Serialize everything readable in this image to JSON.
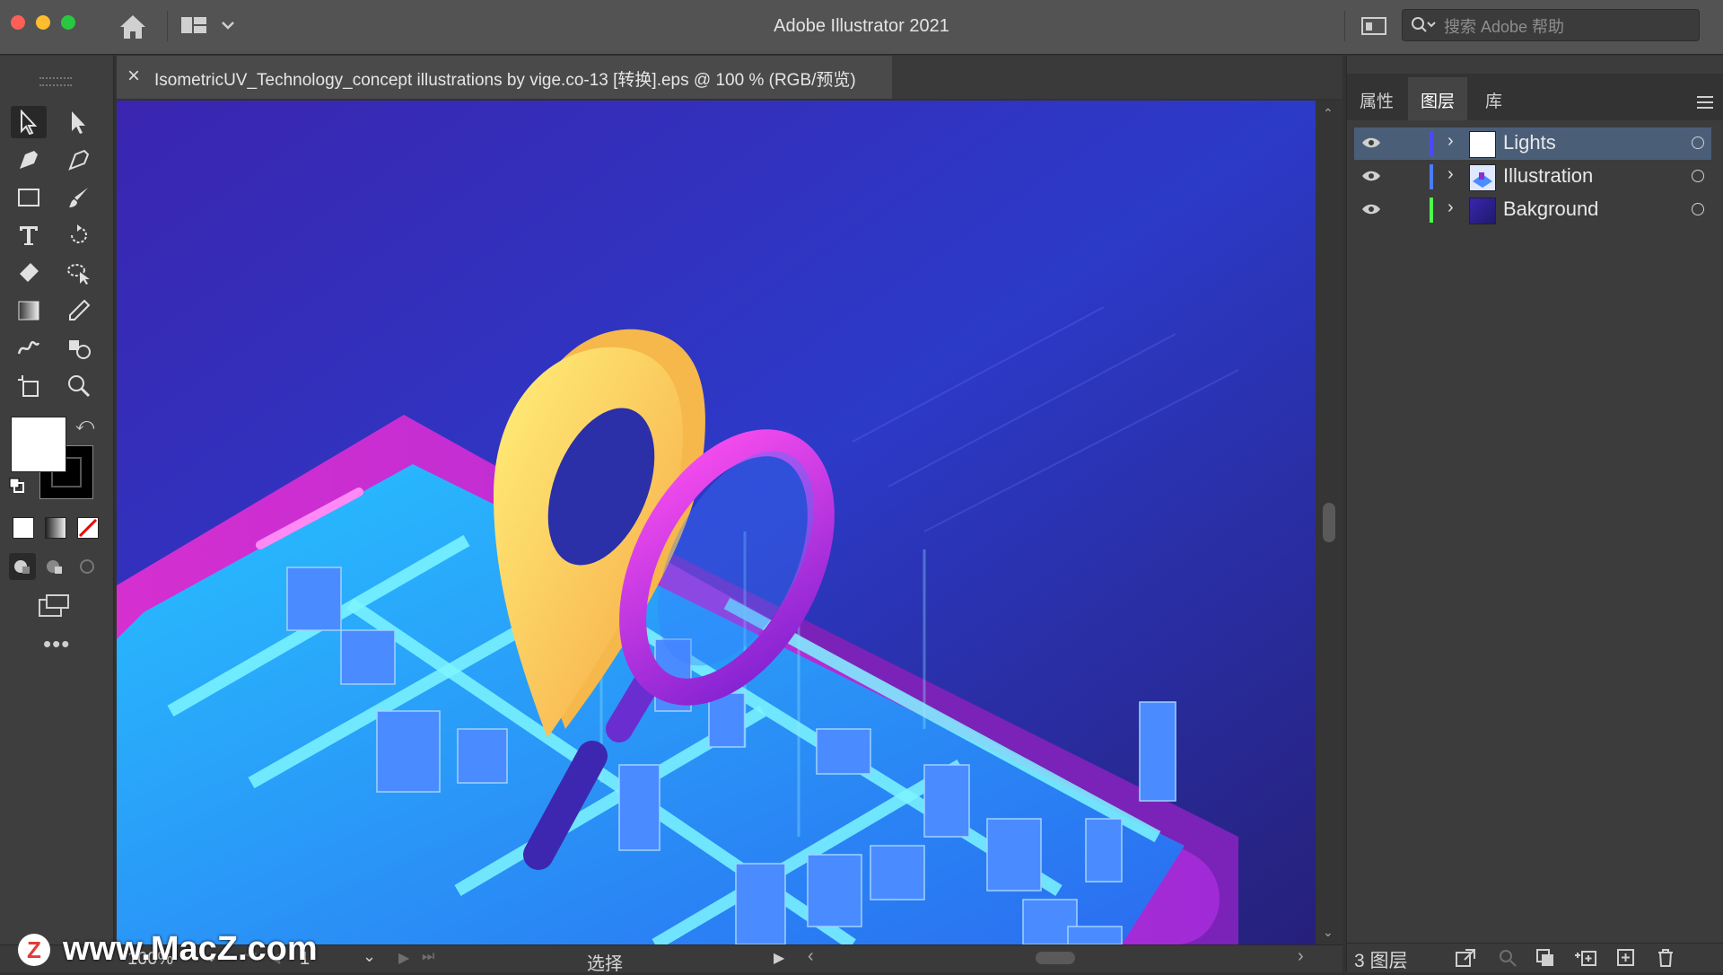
{
  "window": {
    "title": "Adobe Illustrator 2021"
  },
  "search": {
    "placeholder": "搜索 Adobe 帮助"
  },
  "document_tab": {
    "close_glyph": "×",
    "label": "IsometricUV_Technology_concept illustrations by vige.co-13 [转换].eps @ 100 % (RGB/预览)"
  },
  "panel": {
    "tabs": [
      {
        "label": "属性"
      },
      {
        "label": "图层"
      },
      {
        "label": "库"
      }
    ],
    "active_tab": "图层",
    "layers": [
      {
        "name": "Lights",
        "color": "#4a4aff",
        "selected": true
      },
      {
        "name": "Illustration",
        "color": "#4a7cff",
        "selected": false
      },
      {
        "name": "Bakground",
        "color": "#4aff4a",
        "selected": false
      }
    ],
    "layer_count": "3 图层"
  },
  "status": {
    "zoom": "100%",
    "artboard": "1",
    "tool_name": "选择"
  },
  "watermark": {
    "text": "www.MacZ.com",
    "logo_letter": "Z"
  },
  "colors": {
    "accent_selected": "#4b5e78",
    "canvas_bg": "#3a2ab8",
    "pin": "#ffd05a",
    "magnifier": "#d23ee0"
  }
}
